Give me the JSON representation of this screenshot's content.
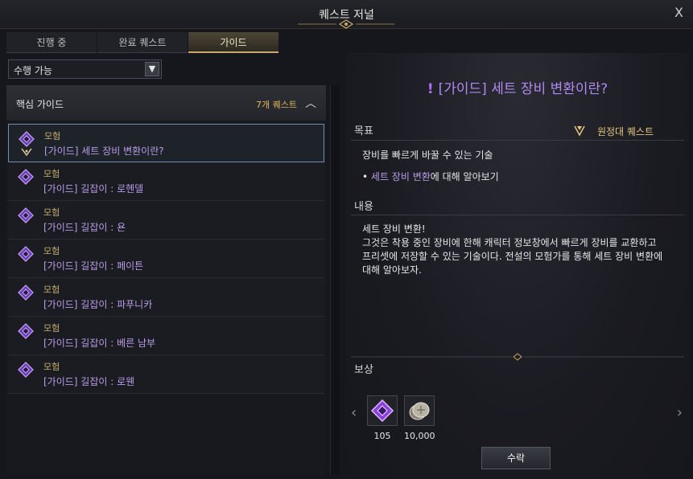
{
  "window": {
    "title": "퀘스트 저널",
    "close_label": "X"
  },
  "tabs": [
    {
      "label": "진행 중",
      "active": false
    },
    {
      "label": "완료 퀘스트",
      "active": false
    },
    {
      "label": "가이드",
      "active": true
    }
  ],
  "filter": {
    "selected": "수행 가능"
  },
  "group": {
    "title": "핵심 가이드",
    "count": "7개 퀘스트"
  },
  "quests": [
    {
      "category": "모험",
      "name": "[가이드] 세트 장비 변환이란?",
      "selected": true
    },
    {
      "category": "모험",
      "name": "[가이드] 길잡이 : 로헨델",
      "selected": false
    },
    {
      "category": "모험",
      "name": "[가이드] 길잡이 : 욘",
      "selected": false
    },
    {
      "category": "모험",
      "name": "[가이드] 길잡이 : 페이튼",
      "selected": false
    },
    {
      "category": "모험",
      "name": "[가이드] 길잡이 : 파푸니카",
      "selected": false
    },
    {
      "category": "모험",
      "name": "[가이드] 길잡이 : 베른 남부",
      "selected": false
    },
    {
      "category": "모험",
      "name": "[가이드] 길잡이 : 로웬",
      "selected": false
    }
  ],
  "detail": {
    "title": "[가이드] 세트 장비 변환이란?",
    "objective_label": "목표",
    "quest_type": "원정대 퀘스트",
    "objective_summary": "장비를 빠르게 바꿀 수 있는 기술",
    "objective_item_prefix": "• ",
    "objective_item_highlight": "세트 장비 변환",
    "objective_item_suffix": "에 대해 알아보기",
    "content_label": "내용",
    "content_line1": "세트 장비 변환!",
    "content_body": "그것은 착용 중인 장비에 한해 캐릭터 정보창에서 빠르게 장비를 교환하고 프리셋에 저장할 수 있는 기술이다. 전설의 모험가를 통해 세트 장비 변환에 대해 알아보자.",
    "rewards_label": "보상",
    "rewards": [
      {
        "icon": "purple-gem-icon",
        "amount": "105"
      },
      {
        "icon": "silver-coin-icon",
        "amount": "10,000"
      }
    ],
    "accept_label": "수락"
  },
  "colors": {
    "accent_gold": "#c9a86a",
    "quest_name": "#b89ce8",
    "title_purple": "#b08af0",
    "selected_border": "#6e8fb0"
  }
}
